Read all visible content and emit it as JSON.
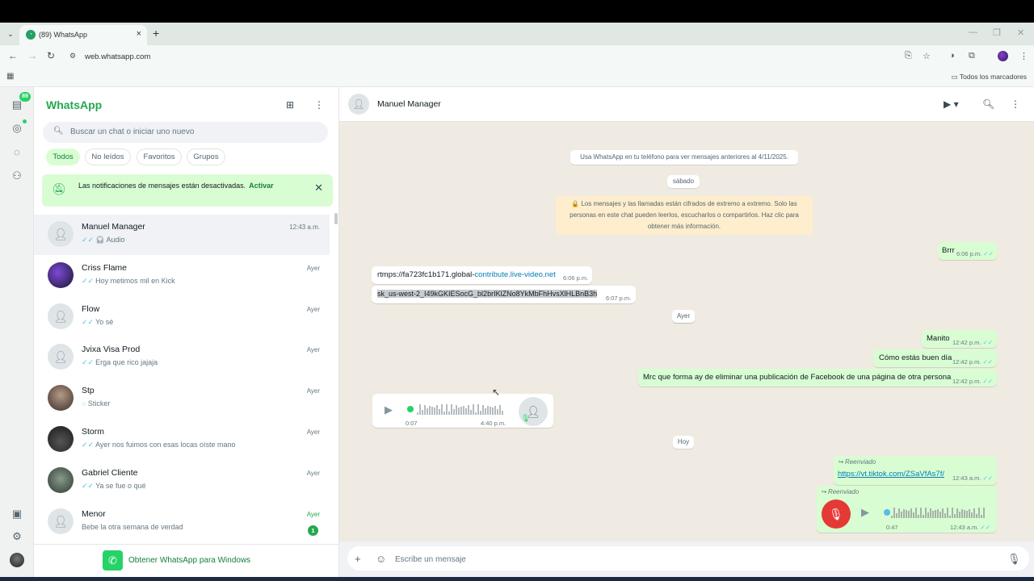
{
  "browser": {
    "tab_title": "(89) WhatsApp",
    "url": "web.whatsapp.com",
    "bookmarks_label": "Todos los marcadores"
  },
  "rail": {
    "chats_badge": "89"
  },
  "sidebar": {
    "brand": "WhatsApp",
    "search_placeholder": "Buscar un chat o iniciar uno nuevo",
    "filters": [
      "Todos",
      "No leídos",
      "Favoritos",
      "Grupos"
    ],
    "notification": {
      "text": "Las notificaciones de mensajes están desactivadas.",
      "action": "Activar"
    },
    "chats": [
      {
        "name": "Manuel Manager",
        "preview": "Audio",
        "time": "12:43 a.m.",
        "avatar": "default-avatar-icon",
        "icon": "headphones-icon"
      },
      {
        "name": "Criss Flame",
        "preview": "Hoy metimos mil en Kick",
        "time": "Ayer",
        "avatar": "photo-avatar"
      },
      {
        "name": "Flow",
        "preview": "Yo sé",
        "time": "Ayer",
        "avatar": "default-avatar-icon"
      },
      {
        "name": "Jvixa Visa Prod",
        "preview": "Erga que rico jajaja",
        "time": "Ayer",
        "avatar": "default-avatar-icon"
      },
      {
        "name": "Stp",
        "preview": "Sticker",
        "time": "Ayer",
        "avatar": "photo-avatar",
        "icon": "sticker-icon"
      },
      {
        "name": "Storm",
        "preview": "Ayer nos fuimos con esas locas oíste mano",
        "time": "Ayer",
        "avatar": "photo-avatar"
      },
      {
        "name": "Gabriel Cliente",
        "preview": "Ya se fue o qué",
        "time": "Ayer",
        "avatar": "photo-avatar"
      },
      {
        "name": "Menor",
        "preview": "Bebe la otra semana de verdad",
        "time": "Ayer",
        "avatar": "default-avatar-icon",
        "unread": "1"
      }
    ],
    "get_app": "Obtener WhatsApp para Windows"
  },
  "conversation": {
    "contact": "Manuel Manager",
    "system_notice": "Usa WhatsApp en tu teléfono para ver mensajes anteriores al 4/11/2025.",
    "day_saturday": "sábado",
    "encryption": "🔒 Los mensajes y las llamadas están cifrados de extremo a extremo. Solo las personas en este chat pueden leerlos, escucharlos o compartirlos. Haz clic para obtener más información.",
    "day_yesterday": "Ayer",
    "day_today": "Hoy",
    "messages": {
      "brrr": {
        "text": "Brrr",
        "time": "6:06 p.m."
      },
      "link1": {
        "prefix": "rtmps://fa723fc1b171.global-",
        "link": "contribute.live-video.net",
        "time": "6:06 p.m."
      },
      "key": {
        "text": "sk_us-west-2_I49kGKIESocG_bl2brIKlZNo8YkMbFhHvsXlHLBnB3h",
        "time": "6:07 p.m."
      },
      "manito": {
        "text": "Manito",
        "time": "12:42 p.m."
      },
      "como": {
        "text": "Cómo estás buen día",
        "time": "12:42 p.m."
      },
      "mrc": {
        "text": "Mrc que forma ay de eliminar una publicación de Facebook de una página de otra persona",
        "time": "12:42 p.m."
      },
      "audio_in": {
        "duration": "0:07",
        "time": "4:40 p.m."
      },
      "fwd_link": {
        "label": "Reenviado",
        "link": "https://vt.tiktok.com/ZSaVfAs7f/",
        "time": "12:43 a.m."
      },
      "fwd_audio": {
        "label": "Reenviado",
        "duration": "0:47",
        "time": "12:43 a.m."
      }
    },
    "composer_placeholder": "Escribe un mensaje"
  },
  "colors": {
    "accent": "#25d366",
    "outgoing": "#d9fdd3",
    "chat_bg": "#efeae2",
    "tick": "#53bdeb"
  }
}
